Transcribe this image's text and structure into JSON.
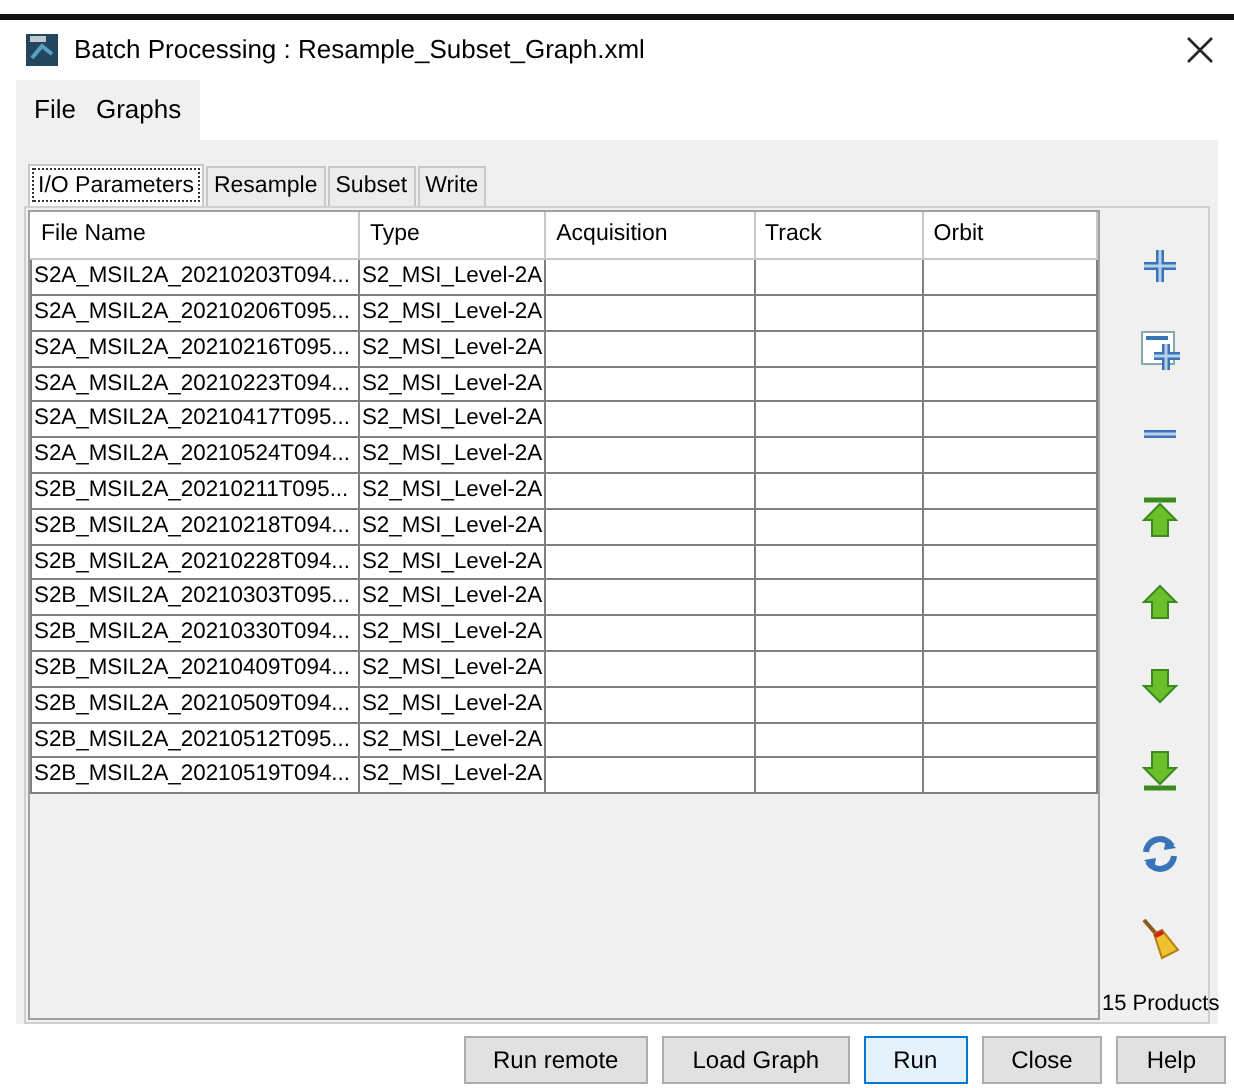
{
  "window": {
    "title": "Batch Processing : Resample_Subset_Graph.xml"
  },
  "menu": [
    "File",
    "Graphs"
  ],
  "tabs": [
    {
      "label": "I/O Parameters",
      "selected": true
    },
    {
      "label": "Resample",
      "selected": false
    },
    {
      "label": "Subset",
      "selected": false
    },
    {
      "label": "Write",
      "selected": false
    }
  ],
  "table": {
    "columns": [
      "File Name",
      "Type",
      "Acquisition",
      "Track",
      "Orbit"
    ],
    "rows": [
      {
        "file_name": "S2A_MSIL2A_20210203T094...",
        "type": "S2_MSI_Level-2A"
      },
      {
        "file_name": "S2A_MSIL2A_20210206T095...",
        "type": "S2_MSI_Level-2A"
      },
      {
        "file_name": "S2A_MSIL2A_20210216T095...",
        "type": "S2_MSI_Level-2A"
      },
      {
        "file_name": "S2A_MSIL2A_20210223T094...",
        "type": "S2_MSI_Level-2A"
      },
      {
        "file_name": "S2A_MSIL2A_20210417T095...",
        "type": "S2_MSI_Level-2A"
      },
      {
        "file_name": "S2A_MSIL2A_20210524T094...",
        "type": "S2_MSI_Level-2A"
      },
      {
        "file_name": "S2B_MSIL2A_20210211T095...",
        "type": "S2_MSI_Level-2A"
      },
      {
        "file_name": "S2B_MSIL2A_20210218T094...",
        "type": "S2_MSI_Level-2A"
      },
      {
        "file_name": "S2B_MSIL2A_20210228T094...",
        "type": "S2_MSI_Level-2A"
      },
      {
        "file_name": "S2B_MSIL2A_20210303T095...",
        "type": "S2_MSI_Level-2A"
      },
      {
        "file_name": "S2B_MSIL2A_20210330T094...",
        "type": "S2_MSI_Level-2A"
      },
      {
        "file_name": "S2B_MSIL2A_20210409T094...",
        "type": "S2_MSI_Level-2A"
      },
      {
        "file_name": "S2B_MSIL2A_20210509T094...",
        "type": "S2_MSI_Level-2A"
      },
      {
        "file_name": "S2B_MSIL2A_20210512T095...",
        "type": "S2_MSI_Level-2A"
      },
      {
        "file_name": "S2B_MSIL2A_20210519T094...",
        "type": "S2_MSI_Level-2A"
      }
    ]
  },
  "side_tools": [
    {
      "kind": "add"
    },
    {
      "kind": "add-all"
    },
    {
      "kind": "remove"
    },
    {
      "kind": "top"
    },
    {
      "kind": "up"
    },
    {
      "kind": "down"
    },
    {
      "kind": "bottom"
    },
    {
      "kind": "refresh"
    },
    {
      "kind": "clear"
    }
  ],
  "product_count": "15 Products",
  "buttons": [
    {
      "label": "Run remote",
      "focused": false
    },
    {
      "label": "Load Graph",
      "focused": false
    },
    {
      "label": "Run",
      "focused": true
    },
    {
      "label": "Close",
      "focused": false
    },
    {
      "label": "Help",
      "focused": false
    }
  ]
}
